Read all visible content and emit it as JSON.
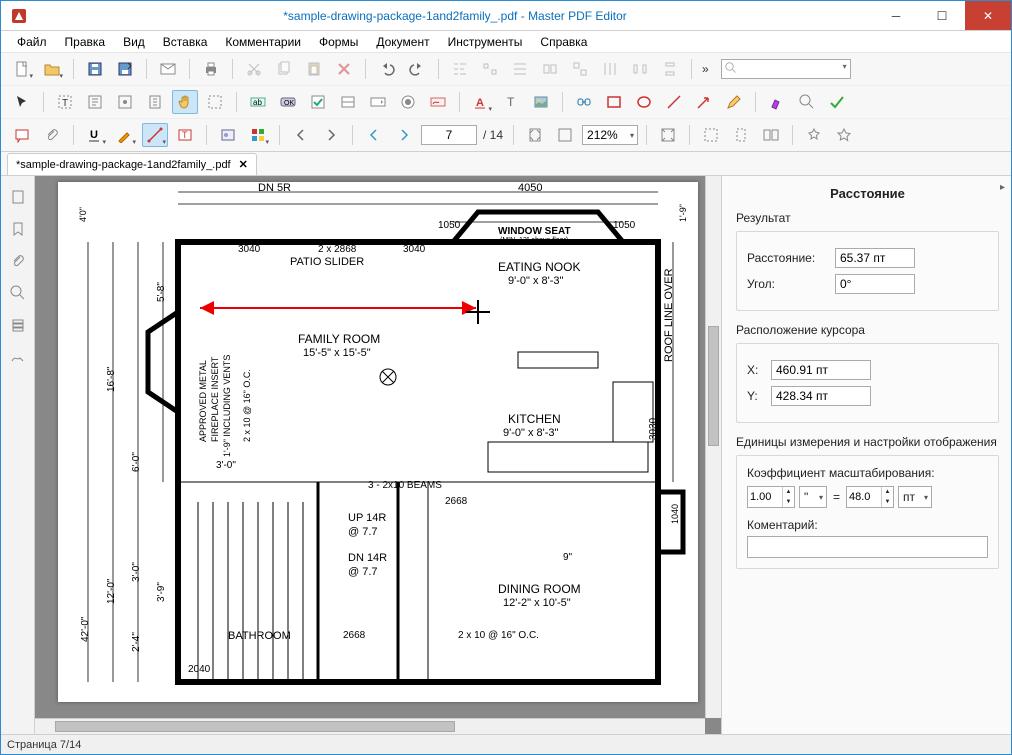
{
  "title": {
    "filename": "*sample-drawing-package-1and2family_.pdf",
    "app": "Master PDF Editor"
  },
  "menu": [
    "Файл",
    "Правка",
    "Вид",
    "Вставка",
    "Комментарии",
    "Формы",
    "Документ",
    "Инструменты",
    "Справка"
  ],
  "toolbar": {
    "search_placeholder": "",
    "page_current": "7",
    "page_total": "/ 14",
    "zoom": "212%",
    "overflow": "»"
  },
  "tab": {
    "label": "*sample-drawing-package-1and2family_.pdf"
  },
  "right": {
    "title": "Расстояние",
    "section_result": "Результат",
    "distance_label": "Расстояние:",
    "distance_value": "65.37 пт",
    "angle_label": "Угол:",
    "angle_value": "0°",
    "section_cursor": "Расположение курсора",
    "x_label": "X:",
    "x_value": "460.91 пт",
    "y_label": "Y:",
    "y_value": "428.34 пт",
    "section_units": "Единицы измерения и настройки отображения",
    "scale_label": "Коэффициент масштабирования:",
    "scale_from": "1.00",
    "unit_from": "\"",
    "eq": "=",
    "scale_to": "48.0",
    "unit_to": "пт",
    "comment_label": "Коментарий:",
    "comment_value": ""
  },
  "floorplan": {
    "dn5r": "DN 5R",
    "d4050": "4050",
    "d1050a": "1050",
    "d1050b": "1050",
    "window_seat": "WINDOW SEAT",
    "window_seat_sub": "(MIN. 12\" above floor)",
    "d3040a": "3040",
    "patio_slider_dim": "2 x 2868",
    "patio_slider": "PATIO SLIDER",
    "d3040b": "3040",
    "eating_nook": "EATING NOOK",
    "eating_nook_dim": "9'-0\"  x  8'-3\"",
    "roof_line": "ROOF LINE OVER",
    "family_room": "FAMILY ROOM",
    "family_room_dim": "15'-5\"  x  15'-5\"",
    "fireplace1": "APPROVED METAL",
    "fireplace2": "FIREPLACE INSERT",
    "fireplace3": "1'-9\" INCLUDING VENTS",
    "fireplace_oc": "2 x 10 @ 16\" O.C.",
    "kitchen": "KITCHEN",
    "kitchen_dim": "9'-0\"  x  8'-3\"",
    "d3030": "3030",
    "d3_0": "3'-0\"",
    "beams": "3 - 2x10 BEAMS",
    "d2668a": "2668",
    "d2668b": "2668",
    "up14r": "UP 14R",
    "up14r_at": "@ 7.7",
    "dn14r": "DN 14R",
    "dn14r_at": "@ 7.7",
    "d1040": "1040",
    "d9in": "9\"",
    "dining": "DINING ROOM",
    "dining_dim": "12'-2\"  x  10'-5\"",
    "bathroom": "BATHROOM",
    "oc_bottom": "2 x 10 @ 16\" O.C.",
    "d2040": "2040",
    "h40": "4'0\"",
    "h19": "1'-9\"",
    "h58": "5'-8\"",
    "h168": "16'-8\"",
    "h60": "6'-0\"",
    "h420": "42'-0\"",
    "h120": "12'-0\"",
    "h30": "3'-0\"",
    "h24": "2'-4\"",
    "h39": "3'-9\""
  },
  "status": {
    "page": "Страница 7/14"
  }
}
